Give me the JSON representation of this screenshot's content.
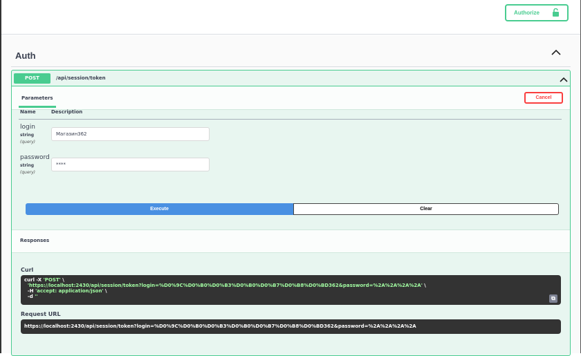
{
  "header": {
    "authorize_label": "Authorize",
    "lock_icon": "unlock-icon"
  },
  "tag": {
    "name": "Auth"
  },
  "operation": {
    "method": "POST",
    "path": "/api/session/token",
    "tab_label": "Parameters",
    "cancel_label": "Cancel",
    "columns": {
      "name": "Name",
      "description": "Description"
    },
    "params": [
      {
        "name": "login",
        "type": "string",
        "in": "(query)",
        "value": "Магазин362"
      },
      {
        "name": "password",
        "type": "string",
        "in": "(query)",
        "value": "****"
      }
    ],
    "execute_label": "Execute",
    "clear_label": "Clear"
  },
  "responses": {
    "title": "Responses",
    "curl_label": "Curl",
    "curl_line1": "curl -X ",
    "curl_method": "'POST'",
    "curl_bs": " \\",
    "curl_url": "'https://localhost:2430/api/session/token?login=%D0%9C%D0%B0%D0%B3%D0%B0%D0%B7%D0%B8%D0%BD362&password=%2A%2A%2A%2A'",
    "curl_h": "-H ",
    "curl_accept": "'accept: application/json'",
    "curl_d": "-d ",
    "curl_data": "''",
    "request_url_label": "Request URL",
    "request_url": "https://localhost:2430/api/session/token?login=%D0%9C%D0%B0%D0%B3%D0%B0%D0%B7%D0%B8%D0%BD362&password=%2A%2A%2A%2A"
  }
}
